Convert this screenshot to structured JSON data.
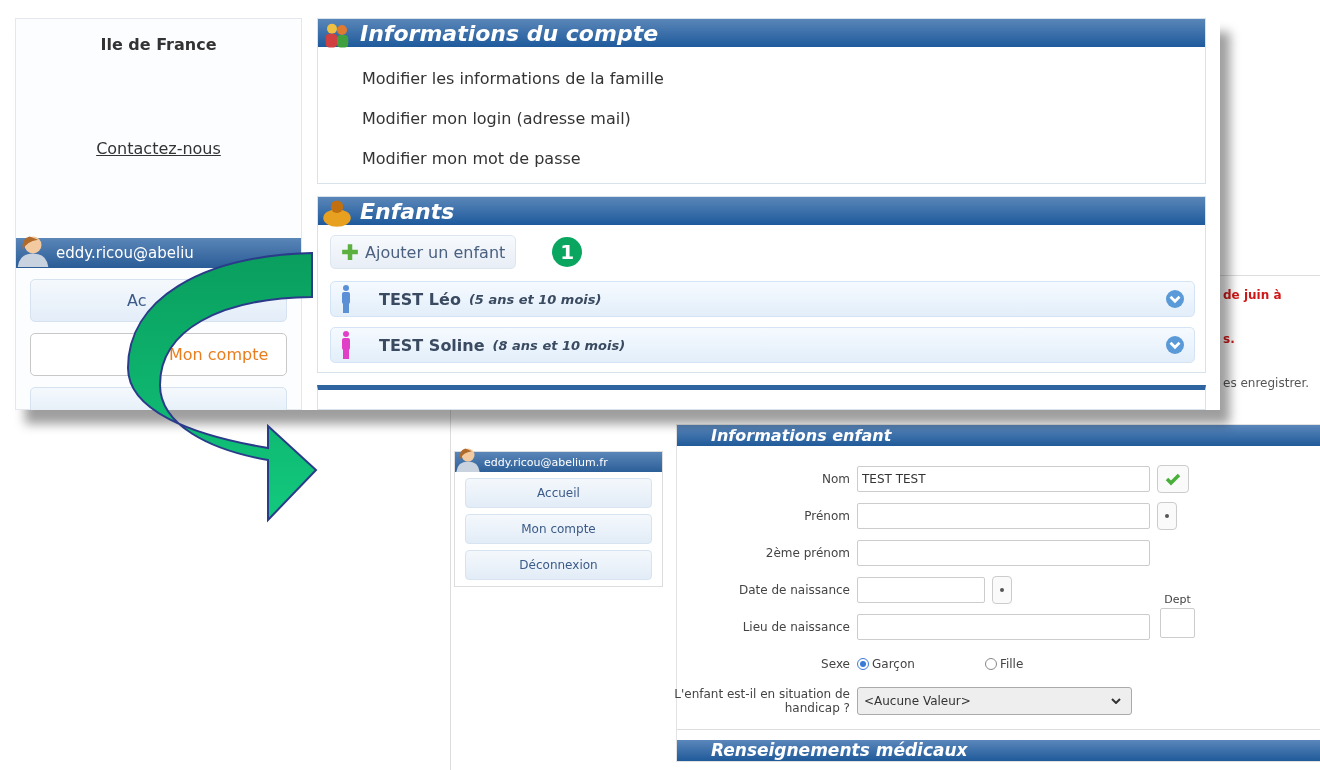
{
  "top_screen": {
    "sidebar": {
      "region": "Ile de France",
      "contact_link": "Contactez-nous",
      "user_email": "eddy.ricou@abeliu",
      "nav": [
        {
          "label": "Ac",
          "selected": false
        },
        {
          "label": "Mon compte",
          "selected": true
        }
      ]
    },
    "account_section": {
      "title": "Informations du compte",
      "links": [
        "Modifier les informations de la famille",
        "Modifier mon login (adresse mail)",
        "Modifier mon mot de passe"
      ]
    },
    "children_section": {
      "title": "Enfants",
      "add_button": "Ajouter un enfant",
      "step_badge": "1",
      "children": [
        {
          "name": "TEST Léo",
          "age": "(5 ans et 10 mois)",
          "color": "#5b8fd6"
        },
        {
          "name": "TEST Soline",
          "age": "(8 ans et 10 mois)",
          "color": "#e23fc8"
        }
      ]
    }
  },
  "background_fragment": [
    {
      "text": "de juin à",
      "kind": "alert"
    },
    {
      "text": "s.",
      "kind": "alert"
    },
    {
      "text": "es enregistrer.",
      "kind": "note"
    }
  ],
  "bottom_screen": {
    "sidebar": {
      "user_email": "eddy.ricou@abelium.fr",
      "nav": [
        "Accueil",
        "Mon compte",
        "Déconnexion"
      ]
    },
    "form": {
      "title": "Informations enfant",
      "fields": [
        {
          "label": "Nom",
          "value": "TEST TEST",
          "kind": "validated"
        },
        {
          "label": "Prénom",
          "kind": "required"
        },
        {
          "label": "2ème prénom",
          "kind": "plain"
        },
        {
          "label": "Date de naissance",
          "kind": "date"
        },
        {
          "label": "Lieu de naissance",
          "kind": "place",
          "extra_label": "Dept"
        }
      ],
      "sex": {
        "label": "Sexe",
        "options": [
          {
            "label": "Garçon",
            "selected": true
          },
          {
            "label": "Fille",
            "selected": false
          }
        ]
      },
      "handicap": {
        "label": "L'enfant est-il en situation de handicap ?",
        "value": "<Aucune Valeur>"
      },
      "next_section": "Renseignements médicaux"
    }
  }
}
